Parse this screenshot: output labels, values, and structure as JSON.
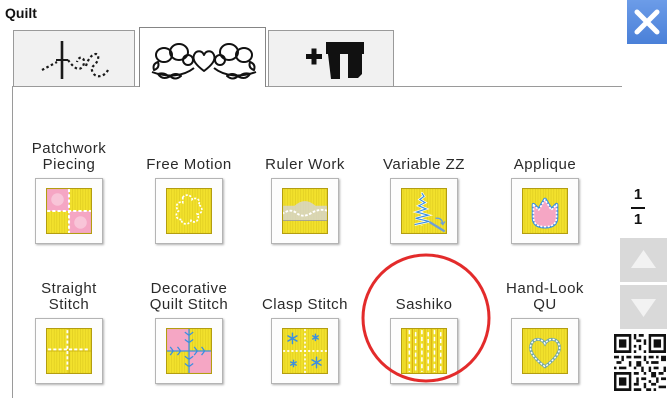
{
  "window": {
    "title": "Quilt",
    "close_icon": "close-icon"
  },
  "tabs": [
    {
      "icon": "needle-stitch-icon",
      "selected": false
    },
    {
      "icon": "decorative-motif-icon",
      "selected": true
    },
    {
      "icon": "add-presser-foot-icon",
      "selected": false
    }
  ],
  "stitch_grid": {
    "rows": [
      [
        {
          "label": [
            "Patchwork",
            "Piecing"
          ],
          "icon": "patchwork-piecing-icon"
        },
        {
          "label": [
            "Free Motion"
          ],
          "icon": "free-motion-icon"
        },
        {
          "label": [
            "Ruler Work"
          ],
          "icon": "ruler-work-icon"
        },
        {
          "label": [
            "Variable ZZ"
          ],
          "icon": "variable-zigzag-icon"
        },
        {
          "label": [
            "Applique"
          ],
          "icon": "applique-icon"
        }
      ],
      [
        {
          "label": [
            "Straight",
            "Stitch"
          ],
          "icon": "straight-stitch-icon"
        },
        {
          "label": [
            "Decorative",
            "Quilt Stitch"
          ],
          "icon": "decorative-quilt-stitch-icon"
        },
        {
          "label": [
            "Clasp Stitch"
          ],
          "icon": "clasp-stitch-icon"
        },
        {
          "label": [
            "Sashiko"
          ],
          "icon": "sashiko-icon"
        },
        {
          "label": [
            "Hand-Look",
            "QU"
          ],
          "icon": "hand-look-quilt-icon"
        }
      ]
    ]
  },
  "pager": {
    "current": "1",
    "total": "1",
    "up_icon": "arrow-up-icon",
    "down_icon": "arrow-down-icon",
    "up_enabled": false,
    "down_enabled": false
  },
  "qr_icon": "qr-code-icon",
  "colors": {
    "close_button": "#4a80d8",
    "fabric_yellow": "#f2e12c",
    "fabric_pink": "#f5a6c4",
    "stitch_blue": "#3b8fe0",
    "highlight_circle": "#e32b2b"
  }
}
